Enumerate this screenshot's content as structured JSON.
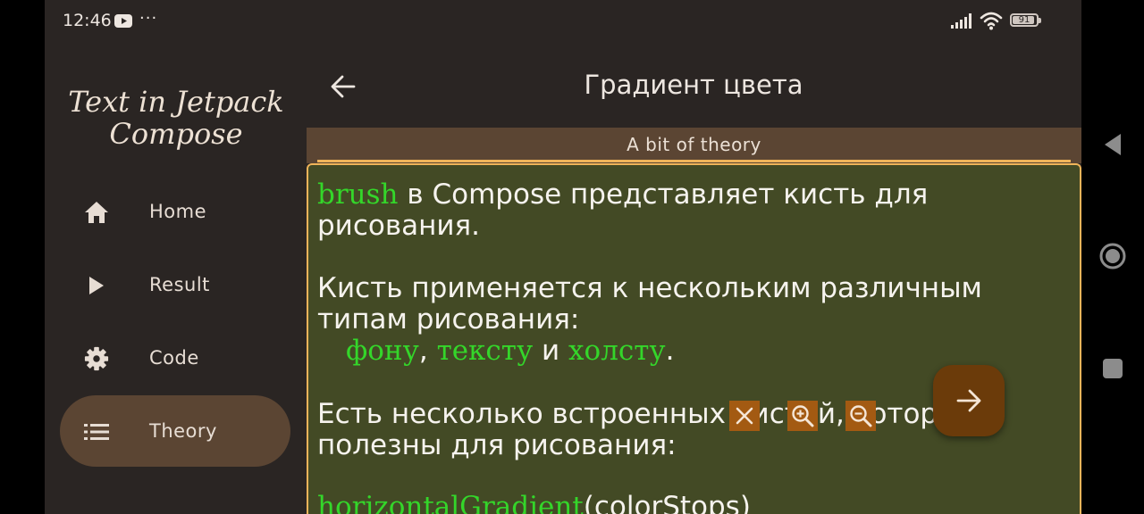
{
  "status_bar": {
    "time": "12:46",
    "overflow": "···",
    "battery_level": "91"
  },
  "drawer": {
    "app_title_line1": "Text in Jetpack",
    "app_title_line2": "Compose",
    "items": [
      {
        "label": "Home",
        "icon": "home-icon"
      },
      {
        "label": "Result",
        "icon": "play-icon"
      },
      {
        "label": "Code",
        "icon": "gear-icon"
      },
      {
        "label": "Theory",
        "icon": "list-icon",
        "selected": true
      }
    ]
  },
  "top_bar": {
    "title": "Градиент цвета"
  },
  "section": {
    "label": "A bit of theory"
  },
  "content": {
    "p1": {
      "code": "brush",
      "text1": " в Compose представляет кисть для",
      "text2": "рисования."
    },
    "p2": {
      "line1": "Кисть применяется к нескольким различным",
      "line2": "типам рисования:",
      "item1": "фону",
      "sep1": ", ",
      "item2": "тексту",
      "sep2": " и ",
      "item3": "холсту",
      "end": "."
    },
    "p3": {
      "line1": "Есть несколько встроенных кистей, которые",
      "line2": "полезны для рисования:"
    },
    "p4": {
      "code": "horizontalGradient",
      "text": "(colorStops)"
    }
  },
  "colors": {
    "background": "#2a2523",
    "accent": "#f0b45a",
    "drawer_selected": "#5b4533",
    "content_bg": "#434a25",
    "code_text": "#34d62a",
    "fab_bg": "#6b3b0a"
  },
  "controls": {
    "close": "close-icon",
    "zoom_in": "zoom-in-icon",
    "zoom_out": "zoom-out-icon",
    "fab": "arrow-right-icon"
  }
}
